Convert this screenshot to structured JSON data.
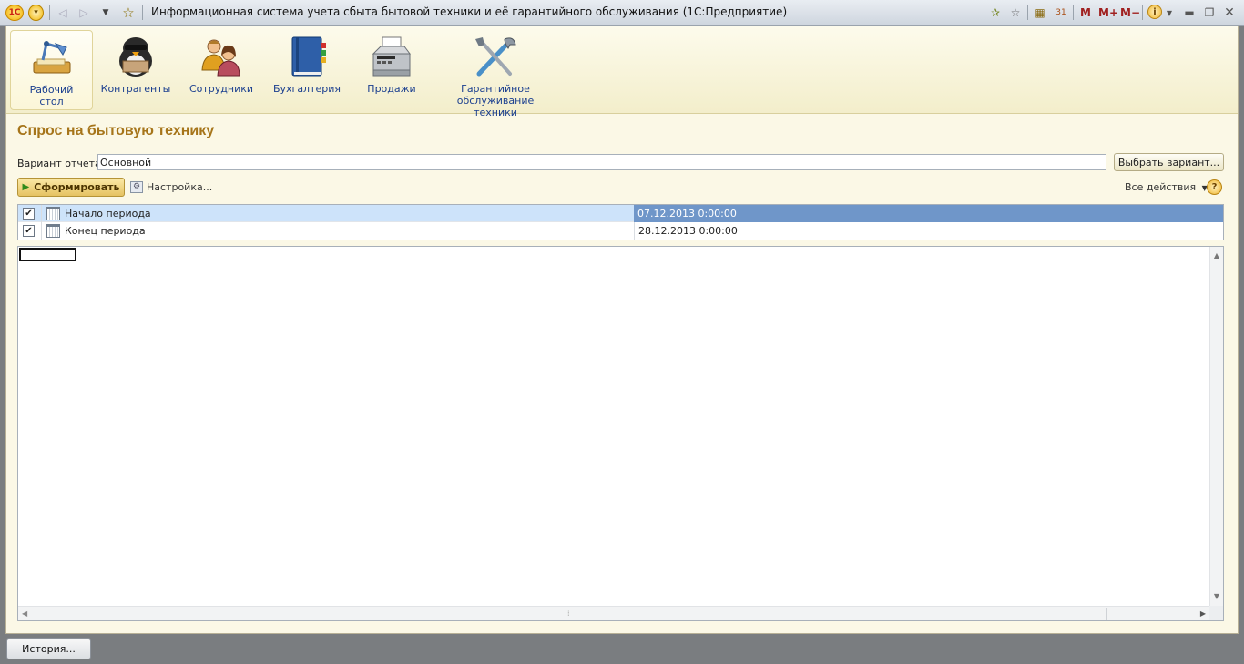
{
  "window": {
    "title": "Информационная система учета сбыта бытовой техники и её гарантийного обслуживания  (1С:Предприятие)",
    "logo": "1С",
    "memory_buttons": [
      "M",
      "M+",
      "M−"
    ],
    "info_icon": "i"
  },
  "sections": [
    {
      "label": "Рабочий стол",
      "icon": "desk-lamp-icon",
      "active": true
    },
    {
      "label": "Контрагенты",
      "icon": "penguin-icon",
      "active": false
    },
    {
      "label": "Сотрудники",
      "icon": "people-icon",
      "active": false
    },
    {
      "label": "Бухгалтерия",
      "icon": "book-icon",
      "active": false
    },
    {
      "label": "Продажи",
      "icon": "cash-register-icon",
      "active": false
    },
    {
      "label": "Гарантийное обслуживание техники",
      "icon": "tools-icon",
      "active": false
    }
  ],
  "page": {
    "title": "Спрос на бытовую технику",
    "variant_label": "Вариант отчета:",
    "variant_value": "Основной",
    "variant_button": "Выбрать вариант...",
    "generate_button": "Сформировать",
    "settings_button": "Настройка...",
    "all_actions": "Все действия",
    "help": "?"
  },
  "params": [
    {
      "name": "Начало периода",
      "value": "07.12.2013 0:00:00",
      "checked": true,
      "selected": true
    },
    {
      "name": "Конец периода",
      "value": "28.12.2013 0:00:00",
      "checked": true,
      "selected": false
    }
  ],
  "footer": {
    "history_button": "История..."
  }
}
